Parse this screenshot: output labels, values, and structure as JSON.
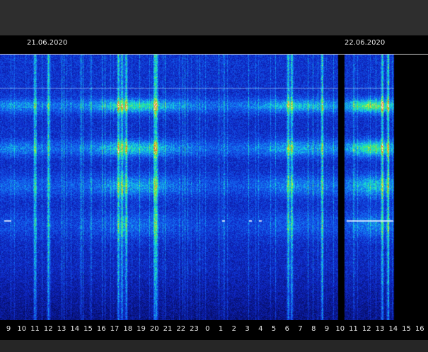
{
  "chart_data": {
    "type": "heatmap",
    "title": "",
    "xlabel": "",
    "ylabel": "",
    "date_labels": [
      "21.06.2020",
      "22.06.2020"
    ],
    "x_tick_labels": [
      "9",
      "10",
      "11",
      "12",
      "13",
      "14",
      "15",
      "16",
      "17",
      "18",
      "19",
      "20",
      "21",
      "22",
      "23",
      "0",
      "1",
      "2",
      "3",
      "4",
      "5",
      "6",
      "7",
      "8",
      "9",
      "10",
      "11",
      "12",
      "13",
      "14",
      "15",
      "16"
    ],
    "data_coverage": {
      "start_hour_label": "8.5",
      "end_hour_label": "14",
      "gap_near_hour": "10"
    },
    "colors": {
      "low": "#0a1a9a",
      "mid": "#10e0c0",
      "high": "#f0f040",
      "peak": "#ffffff",
      "background": "#000000"
    }
  }
}
